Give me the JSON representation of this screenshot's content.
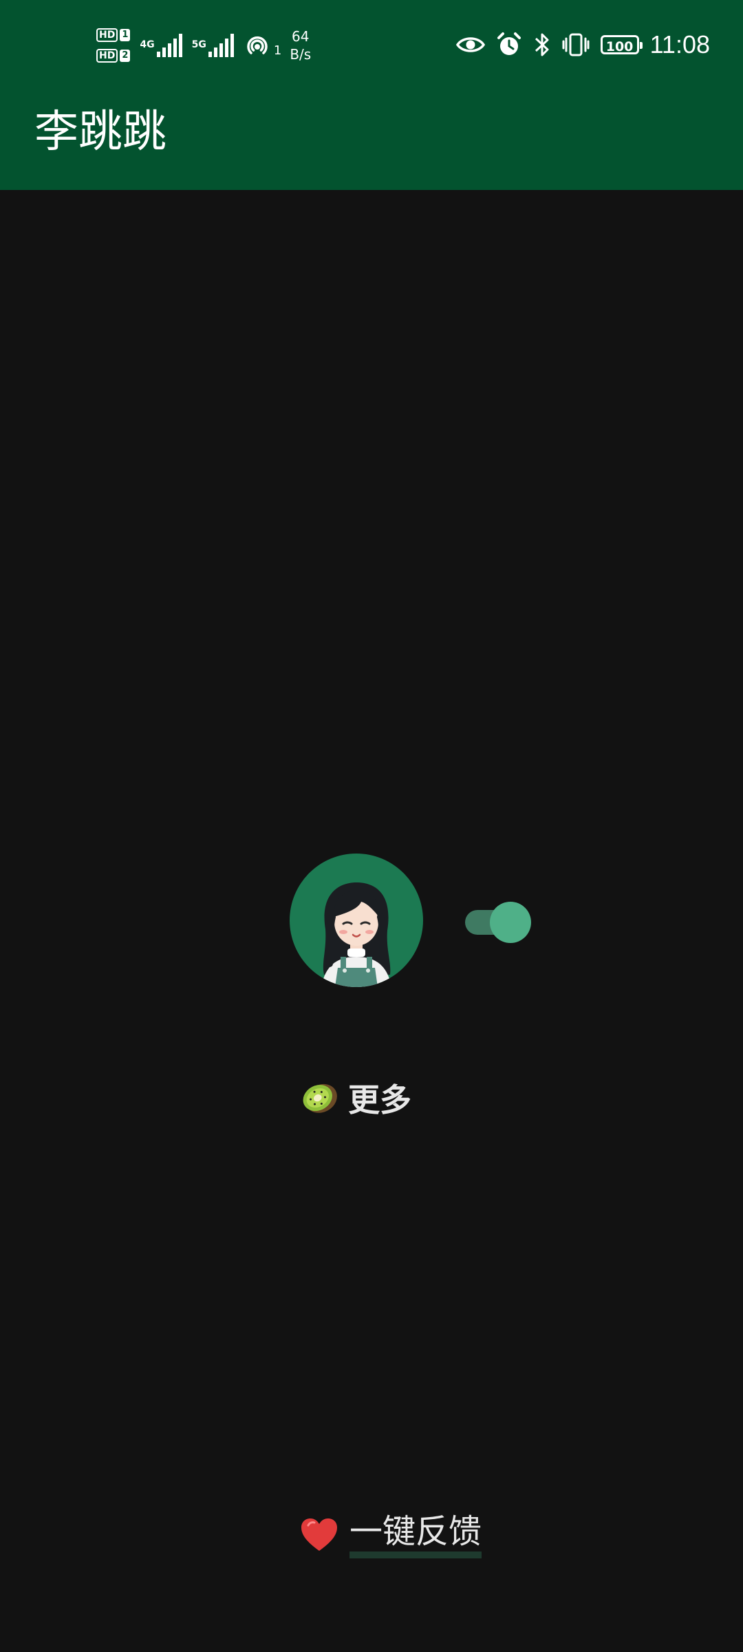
{
  "status_bar": {
    "sim1_badge": "HD",
    "sim1_slot": "1",
    "sim2_badge": "HD",
    "sim2_slot": "2",
    "network1": "4G",
    "network2": "5G",
    "hotspot_count": "1",
    "net_speed_value": "64",
    "net_speed_unit": "B/s",
    "battery": "100",
    "time": "11:08"
  },
  "app_bar": {
    "title": "李跳跳"
  },
  "main": {
    "avatar_icon": "girl-avatar",
    "toggle_on": true,
    "more_label": "更多",
    "more_icon": "kiwi-emoji",
    "feedback_label": "一键反馈",
    "feedback_icon": "heart-emoji"
  },
  "colors": {
    "app_bar": "#03532f",
    "background": "#121212",
    "avatar_bg": "#1c7a52",
    "toggle_thumb": "#4fb088",
    "toggle_track": "#3f7a62"
  }
}
